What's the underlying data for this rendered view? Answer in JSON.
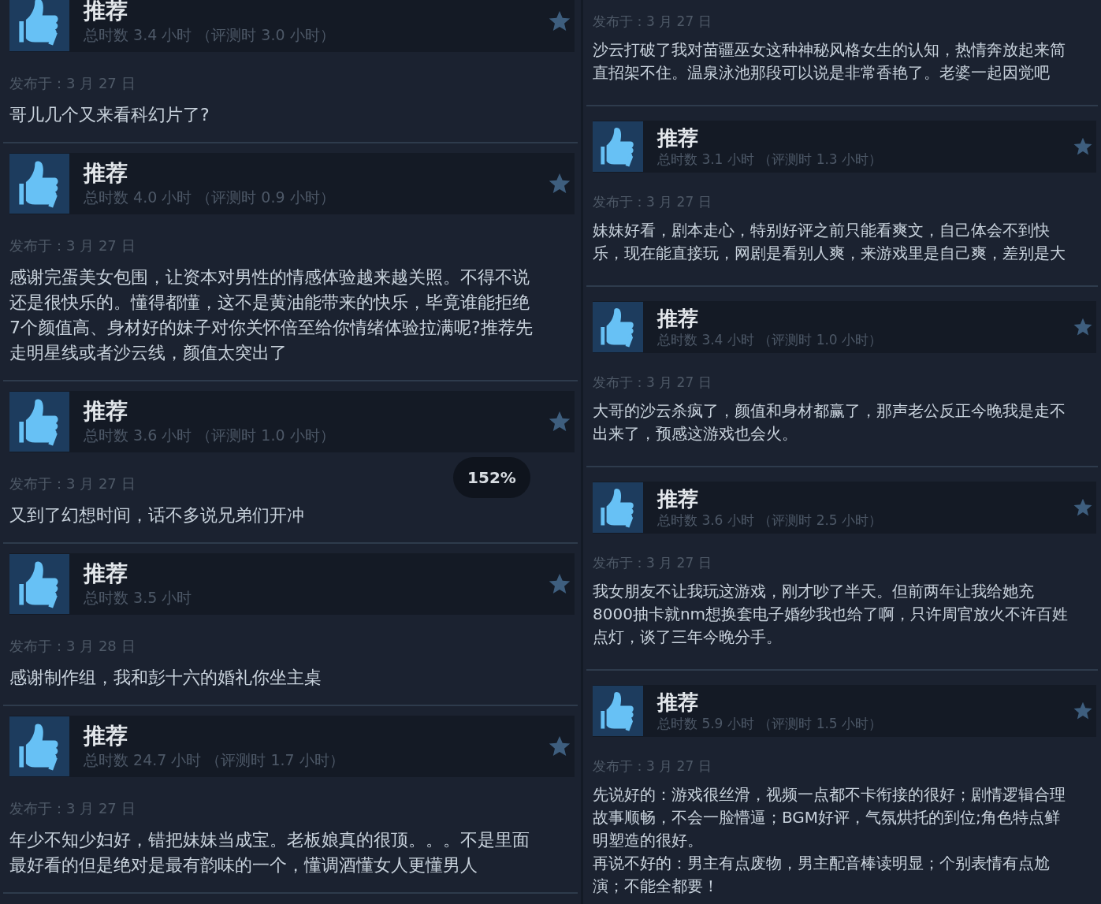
{
  "columns": [
    {
      "reviews": [
        {
          "header": {
            "label": "推荐",
            "hours": "总时数 3.4 小时 （评测时 3.0 小时）"
          },
          "date": "发布于：3 月 27 日",
          "lines": [
            "哥儿几个又来看科幻片了?"
          ]
        },
        {
          "header": {
            "label": "推荐",
            "hours": "总时数 4.0 小时 （评测时 0.9 小时）"
          },
          "date": "发布于：3 月 27 日",
          "lines": [
            "感谢完蛋美女包围，让资本对男性的情感体验越来越关照。不得不说",
            "还是很快乐的。懂得都懂，这不是黄油能带来的快乐，毕竟谁能拒绝",
            "7个颜值高、身材好的妹子对你关怀倍至给你情绪体验拉满呢?推荐先",
            "走明星线或者沙云线，颜值太突出了"
          ]
        },
        {
          "header": {
            "label": "推荐",
            "hours": "总时数 3.6 小时 （评测时 1.0 小时）"
          },
          "date": "发布于：3 月 27 日",
          "lines": [
            "又到了幻想时间，话不多说兄弟们开冲"
          ]
        },
        {
          "header": {
            "label": "推荐",
            "hours": "总时数 3.5 小时"
          },
          "date": "发布于：3 月 28 日",
          "lines": [
            "感谢制作组，我和彭十六的婚礼你坐主桌"
          ]
        },
        {
          "header": {
            "label": "推荐",
            "hours": "总时数 24.7 小时 （评测时 1.7 小时）"
          },
          "date": "发布于：3 月 27 日",
          "lines": [
            "年少不知少妇好，错把妹妹当成宝。老板娘真的很顶。。。不是里面",
            "最好看的但是绝对是最有韵味的一个，懂调酒懂女人更懂男人"
          ]
        }
      ]
    },
    {
      "reviews": [
        {
          "date": "发布于：3 月 27 日",
          "lines": [
            "沙云打破了我对苗疆巫女这种神秘风格女生的认知，热情奔放起来简",
            "直招架不住。温泉泳池那段可以说是非常香艳了。老婆一起因觉吧"
          ]
        },
        {
          "header": {
            "label": "推荐",
            "hours": "总时数 3.1 小时 （评测时 1.3 小时）"
          },
          "date": "发布于：3 月 27 日",
          "lines": [
            "妹妹好看，剧本走心，特别好评之前只能看爽文，自己体会不到快",
            "乐，现在能直接玩，网剧是看别人爽，来游戏里是自己爽，差别是大"
          ]
        },
        {
          "header": {
            "label": "推荐",
            "hours": "总时数 3.4 小时 （评测时 1.0 小时）"
          },
          "date": "发布于：3 月 27 日",
          "lines": [
            "大哥的沙云杀疯了，颜值和身材都赢了，那声老公反正今晚我是走不",
            "出来了，预感这游戏也会火。"
          ]
        },
        {
          "header": {
            "label": "推荐",
            "hours": "总时数 3.6 小时 （评测时 2.5 小时）"
          },
          "date": "发布于：3 月 27 日",
          "lines": [
            "我女朋友不让我玩这游戏，刚才吵了半天。但前两年让我给她充",
            "8000抽卡就nm想换套电子婚纱我也给了啊，只许周官放火不许百姓",
            "点灯，谈了三年今晚分手。"
          ]
        },
        {
          "header": {
            "label": "推荐",
            "hours": "总时数 5.9 小时 （评测时 1.5 小时）"
          },
          "date": "发布于：3 月 27 日",
          "lines": [
            "先说好的：游戏很丝滑，视频一点都不卡衔接的很好；剧情逻辑合理",
            "故事顺畅，不会一脸懵逼；BGM好评，气氛烘托的到位;角色特点鲜",
            "明塑造的很好。",
            "再说不好的：男主有点废物，男主配音棒读明显；个别表情有点尬",
            "演；不能全都要！"
          ]
        }
      ]
    }
  ],
  "zoom_indicator": "152%"
}
